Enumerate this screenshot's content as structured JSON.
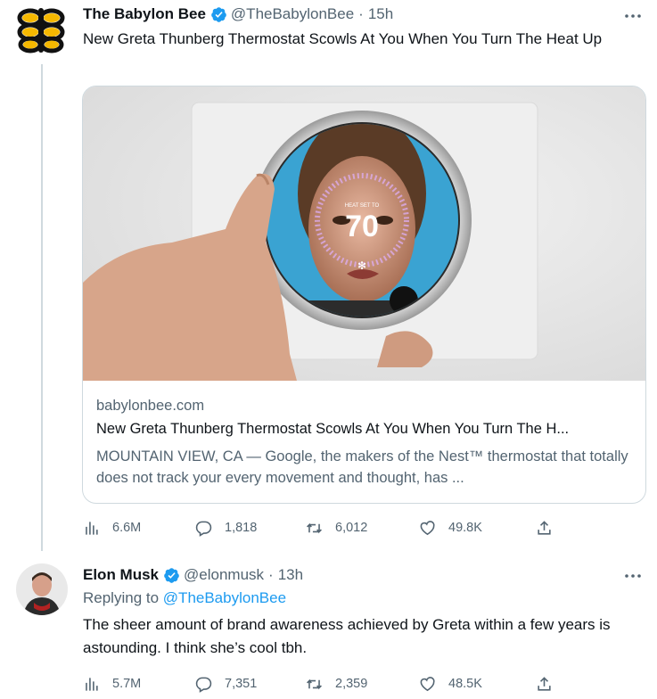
{
  "tweets": [
    {
      "name": "The Babylon Bee",
      "handle": "@TheBabylonBee",
      "separator": "·",
      "time": "15h",
      "text": "New Greta Thunberg Thermostat Scowls At You When You Turn The Heat Up",
      "card": {
        "domain": "babylonbee.com",
        "title": "New Greta Thunberg Thermostat Scowls At You When You Turn The H...",
        "description": "MOUNTAIN VIEW, CA — Google, the makers of the Nest™ thermostat that totally does not track your every movement and thought, has ...",
        "image_text_small": "HEAT SET TO",
        "image_text_big": "70"
      },
      "stats": {
        "views": "6.6M",
        "replies": "1,818",
        "retweets": "6,012",
        "likes": "49.8K"
      }
    },
    {
      "name": "Elon Musk",
      "handle": "@elonmusk",
      "separator": "·",
      "time": "13h",
      "replying_prefix": "Replying to",
      "replying_handle": "@TheBabylonBee",
      "text": "The sheer amount of brand awareness achieved by Greta within a few years is astounding. I think she’s cool tbh.",
      "stats": {
        "views": "5.7M",
        "replies": "7,351",
        "retweets": "2,359",
        "likes": "48.5K"
      }
    }
  ],
  "colors": {
    "accent": "#1d9bf0",
    "muted": "#536471",
    "border": "#cfd9de",
    "bee": "#f5b800"
  },
  "icons": [
    "babylon-bee-logo",
    "verified-badge-icon",
    "more-icon",
    "views-icon",
    "reply-icon",
    "retweet-icon",
    "like-icon",
    "share-icon"
  ]
}
